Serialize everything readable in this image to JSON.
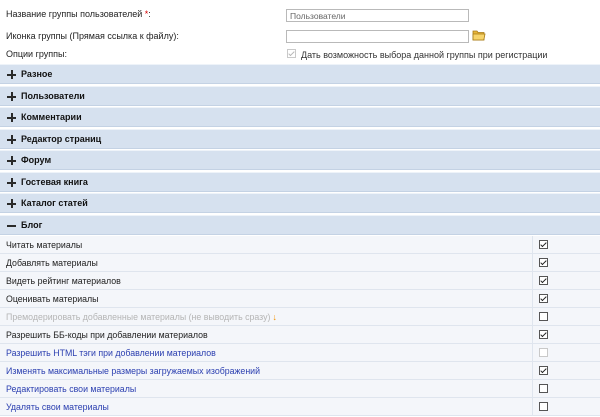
{
  "form": {
    "group_name_label": "Название группы пользователей ",
    "required_mark": "*",
    "label_colon": ":",
    "group_name_value": "Пользователи",
    "icon_label": "Иконка группы (Прямая ссылка к файлу):",
    "icon_value": "",
    "options_label": "Опции группы:",
    "option_registration_label": "Дать возможность выбора данной группы при регистрации",
    "option_registration_checked": true
  },
  "sections": [
    {
      "title": "Разное",
      "expanded": false
    },
    {
      "title": "Пользователи",
      "expanded": false
    },
    {
      "title": "Комментарии",
      "expanded": false
    },
    {
      "title": "Редактор страниц",
      "expanded": false
    },
    {
      "title": "Форум",
      "expanded": false
    },
    {
      "title": "Гостевая книга",
      "expanded": false
    },
    {
      "title": "Каталог статей",
      "expanded": false
    },
    {
      "title": "Блог",
      "expanded": true
    }
  ],
  "blog_permissions": [
    {
      "label": "Читать материалы",
      "checked": true,
      "state": "normal"
    },
    {
      "label": "Добавлять материалы",
      "checked": true,
      "state": "normal"
    },
    {
      "label": "Видеть рейтинг материалов",
      "checked": true,
      "state": "normal"
    },
    {
      "label": "Оценивать материалы",
      "checked": true,
      "state": "normal"
    },
    {
      "label": "Премодерировать добавленные материалы (не выводить сразу)",
      "checked": false,
      "state": "disabled",
      "warning_glyph": "↓"
    },
    {
      "label": "Разрешить ББ-коды при добавлении материалов",
      "checked": true,
      "state": "normal"
    },
    {
      "label": "Разрешить HTML тэги при добавлении материалов",
      "checked": false,
      "state": "link-disabled"
    },
    {
      "label": "Изменять максимальные размеры загружаемых изображений",
      "checked": true,
      "state": "link"
    },
    {
      "label": "Редактировать свои материалы",
      "checked": false,
      "state": "link"
    },
    {
      "label": "Удалять свои материалы",
      "checked": false,
      "state": "link"
    }
  ],
  "colors": {
    "section_bg": "#d6e1ef",
    "required": "#d40000",
    "link_text": "#2b3fb0",
    "warning": "#f39200"
  }
}
